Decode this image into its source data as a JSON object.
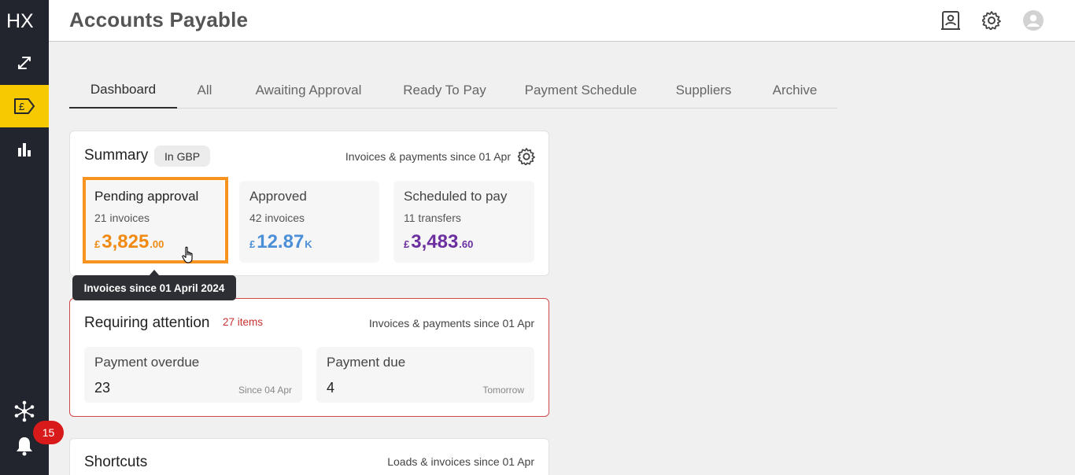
{
  "app": {
    "logo": "HX",
    "page_title": "Accounts Payable",
    "notifications_count": "15"
  },
  "sidebar": {
    "items": [
      {
        "name": "connections",
        "icon": "link-icon"
      },
      {
        "name": "accounts-payable",
        "icon": "pound-tag-icon",
        "active": true
      },
      {
        "name": "reports",
        "icon": "bar-chart-icon"
      }
    ],
    "bottom": [
      {
        "name": "network",
        "icon": "network-icon"
      },
      {
        "name": "notifications",
        "icon": "bell-icon"
      }
    ]
  },
  "topbar": {
    "icons": [
      "contacts-icon",
      "gear-icon",
      "user-avatar-icon"
    ]
  },
  "tabs": [
    {
      "label": "Dashboard",
      "active": true
    },
    {
      "label": "All"
    },
    {
      "label": "Awaiting Approval"
    },
    {
      "label": "Ready To Pay"
    },
    {
      "label": "Payment Schedule"
    },
    {
      "label": "Suppliers"
    },
    {
      "label": "Archive"
    }
  ],
  "summary": {
    "title": "Summary",
    "currency_pill": "In GBP",
    "meta": "Invoices & payments since 01 Apr",
    "tiles": [
      {
        "title": "Pending approval",
        "sub": "21 invoices",
        "currency": "£",
        "main": "3,825",
        "small": ".00",
        "color": "#f08a12"
      },
      {
        "title": "Approved",
        "sub": "42 invoices",
        "currency": "£",
        "main": "12.87",
        "small": "K",
        "color": "#4a8fd8"
      },
      {
        "title": "Scheduled to pay",
        "sub": "11 transfers",
        "currency": "£",
        "main": "3,483",
        "small": ".60",
        "color": "#6b2fa0"
      }
    ]
  },
  "tooltip": {
    "text": "Invoices since 01 April 2024"
  },
  "attention": {
    "title": "Requiring attention",
    "count": "27 items",
    "meta": "Invoices & payments since 01 Apr",
    "tiles": [
      {
        "title": "Payment overdue",
        "value": "23",
        "note": "Since 04 Apr"
      },
      {
        "title": "Payment due",
        "value": "4",
        "note": "Tomorrow"
      }
    ]
  },
  "shortcuts": {
    "title": "Shortcuts",
    "meta": "Loads & invoices since 01 Apr"
  }
}
